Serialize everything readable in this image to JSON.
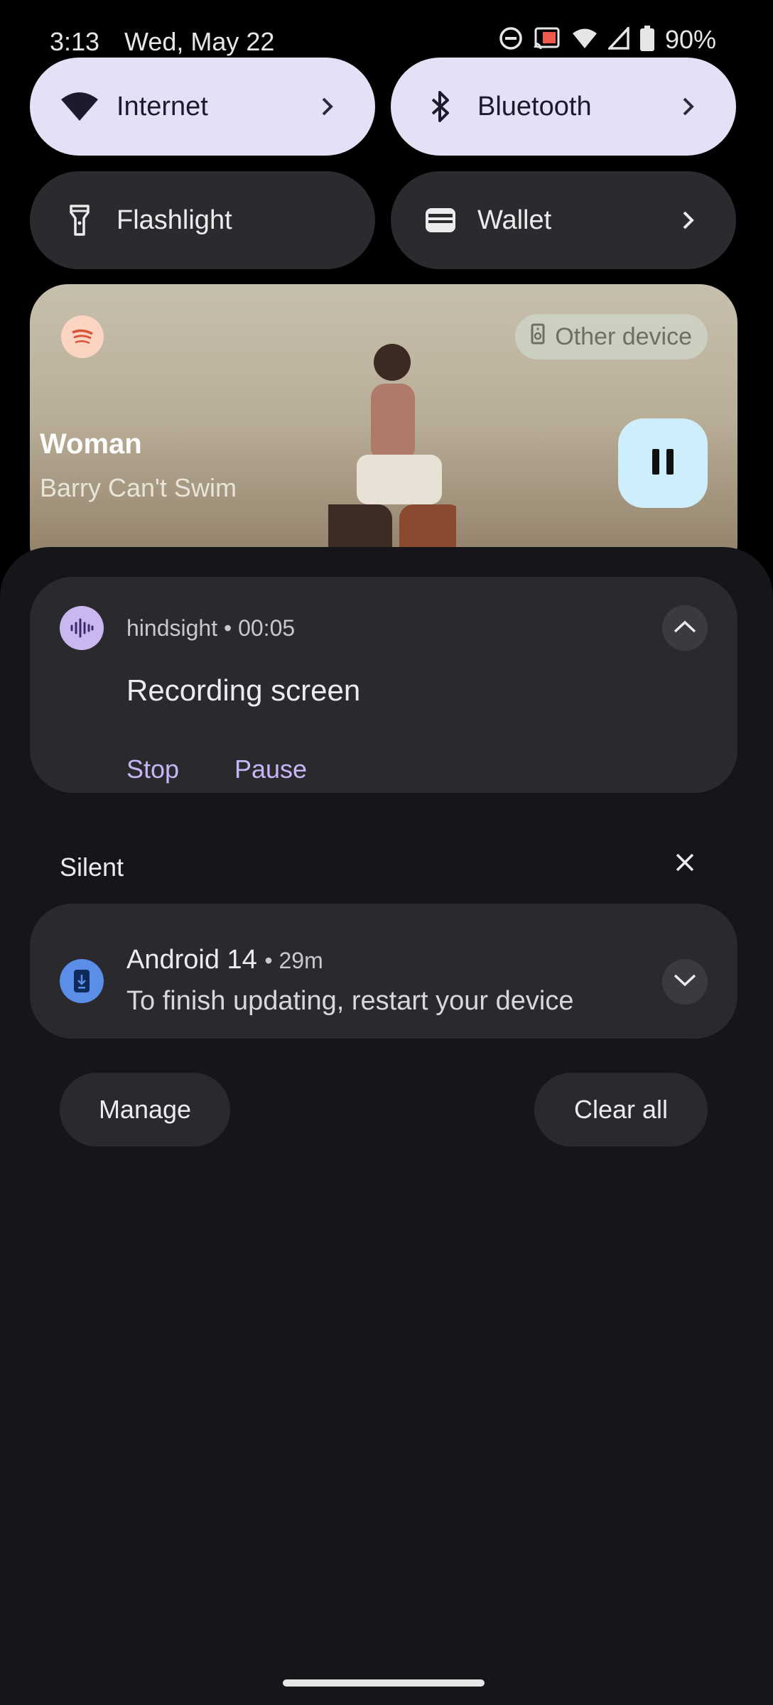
{
  "status_bar": {
    "time": "3:13",
    "date": "Wed, May 22",
    "battery": "90%",
    "icons": [
      "do-not-disturb-icon",
      "cast-icon",
      "wifi-icon",
      "signal-icon",
      "battery-icon"
    ]
  },
  "quick_tiles": [
    {
      "label": "Internet",
      "icon": "wifi-icon",
      "active": true,
      "has_chevron": true
    },
    {
      "label": "Bluetooth",
      "icon": "bluetooth-icon",
      "active": true,
      "has_chevron": true
    },
    {
      "label": "Flashlight",
      "icon": "flashlight-icon",
      "active": false,
      "has_chevron": false
    },
    {
      "label": "Wallet",
      "icon": "wallet-icon",
      "active": false,
      "has_chevron": true
    }
  ],
  "media": {
    "app_icon": "spotify-icon",
    "output_label": "Other device",
    "title": "Woman",
    "artist": "Barry Can't Swim",
    "control": "pause-icon"
  },
  "notifications": {
    "recording": {
      "app": "hindsight",
      "time": "00:05",
      "title": "Recording screen",
      "actions": [
        "Stop",
        "Pause"
      ]
    },
    "section_label": "Silent",
    "update": {
      "app": "Android 14",
      "time": "29m",
      "text": "To finish updating, restart your device"
    }
  },
  "footer": {
    "manage": "Manage",
    "clear_all": "Clear all"
  },
  "colors": {
    "tile_active": "#e4e0f6",
    "tile_inactive": "#2b2b2f",
    "shade_bg": "#16161a",
    "card_bg": "#2a292e",
    "accent_action": "#c7b6f6",
    "pause_button": "#cdeefa"
  }
}
